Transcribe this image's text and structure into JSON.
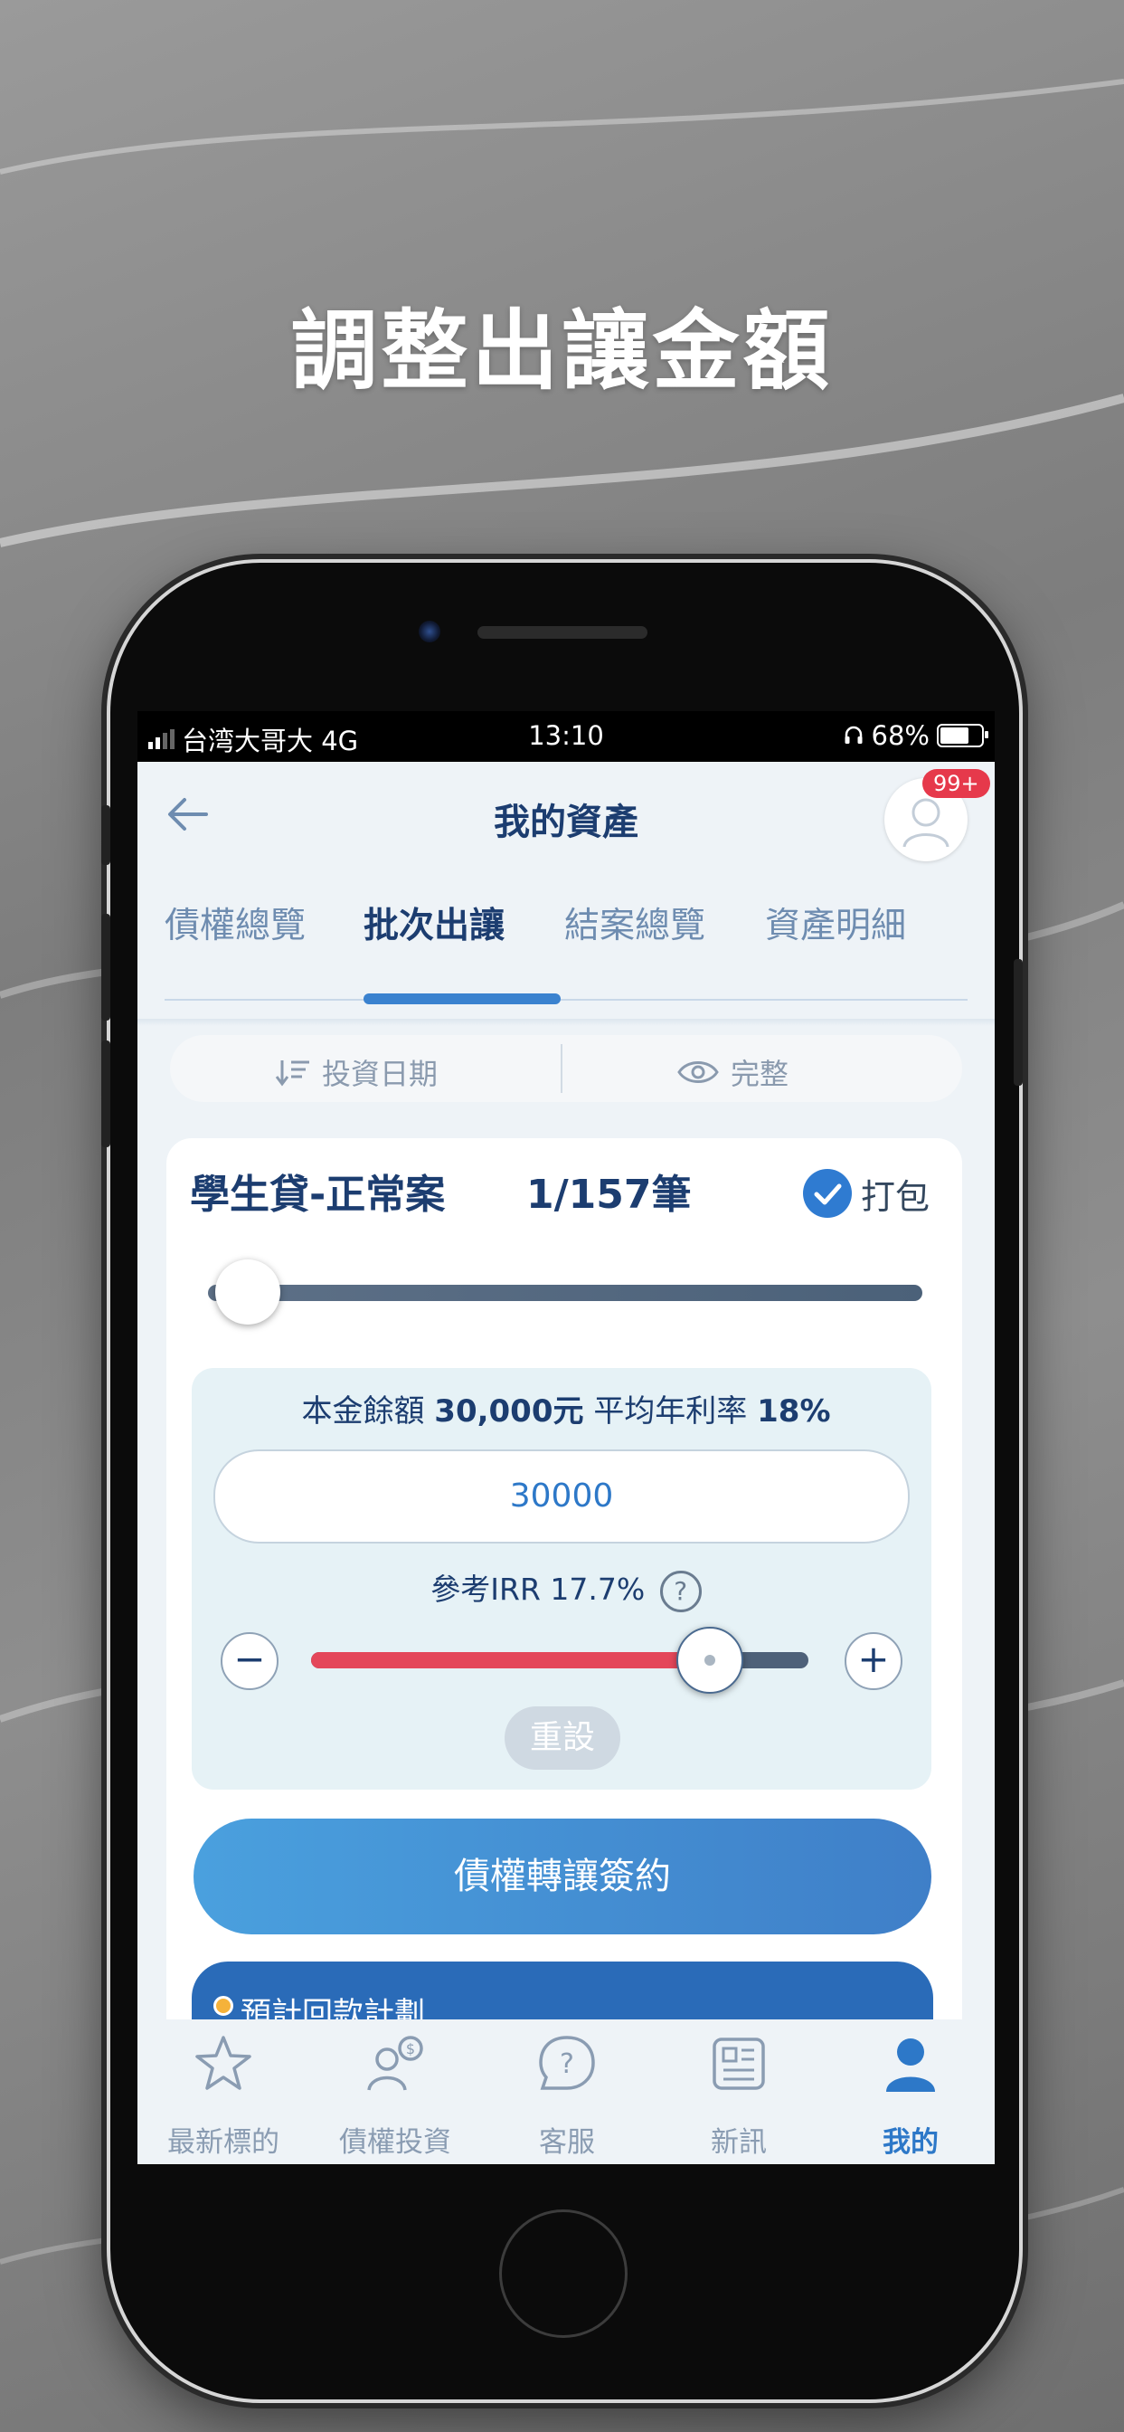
{
  "headline": "調整出讓金額",
  "status_bar": {
    "carrier": "台湾大哥大 4G",
    "time": "13:10",
    "battery": "68%"
  },
  "header": {
    "title": "我的資產",
    "notification_badge": "99+"
  },
  "tabs": [
    {
      "label": "債權總覽",
      "active": false
    },
    {
      "label": "批次出讓",
      "active": true
    },
    {
      "label": "結案總覽",
      "active": false
    },
    {
      "label": "資產明細",
      "active": false
    }
  ],
  "filters": {
    "sort_label": "投資日期",
    "view_label": "完整"
  },
  "card": {
    "title": "學生貸-正常案",
    "count": "1/157筆",
    "pack_label": "打包",
    "pack_checked": true,
    "summary_prefix": "本金餘額",
    "principal": "30,000元",
    "rate_label": "平均年利率",
    "rate": "18%",
    "amount_value": "30000",
    "irr_label": "參考IRR 17.7%",
    "irr_slider_level": 0.8,
    "minus": "−",
    "plus": "+",
    "reset_label": "重設",
    "sign_button": "債權轉讓簽約",
    "plan_label": "預計回款計劃"
  },
  "bottom_nav": [
    {
      "label": "最新標的",
      "icon": "star-icon",
      "active": false
    },
    {
      "label": "債權投資",
      "icon": "investor-dollar-icon",
      "active": false
    },
    {
      "label": "客服",
      "icon": "help-bubble-icon",
      "active": false
    },
    {
      "label": "新訊",
      "icon": "news-icon",
      "active": false
    },
    {
      "label": "我的",
      "icon": "user-icon",
      "active": true
    }
  ],
  "colors": {
    "accent": "#2d78c8",
    "title": "#1c3d70",
    "slider_fill": "#e4475a",
    "badge": "#e6394b"
  }
}
